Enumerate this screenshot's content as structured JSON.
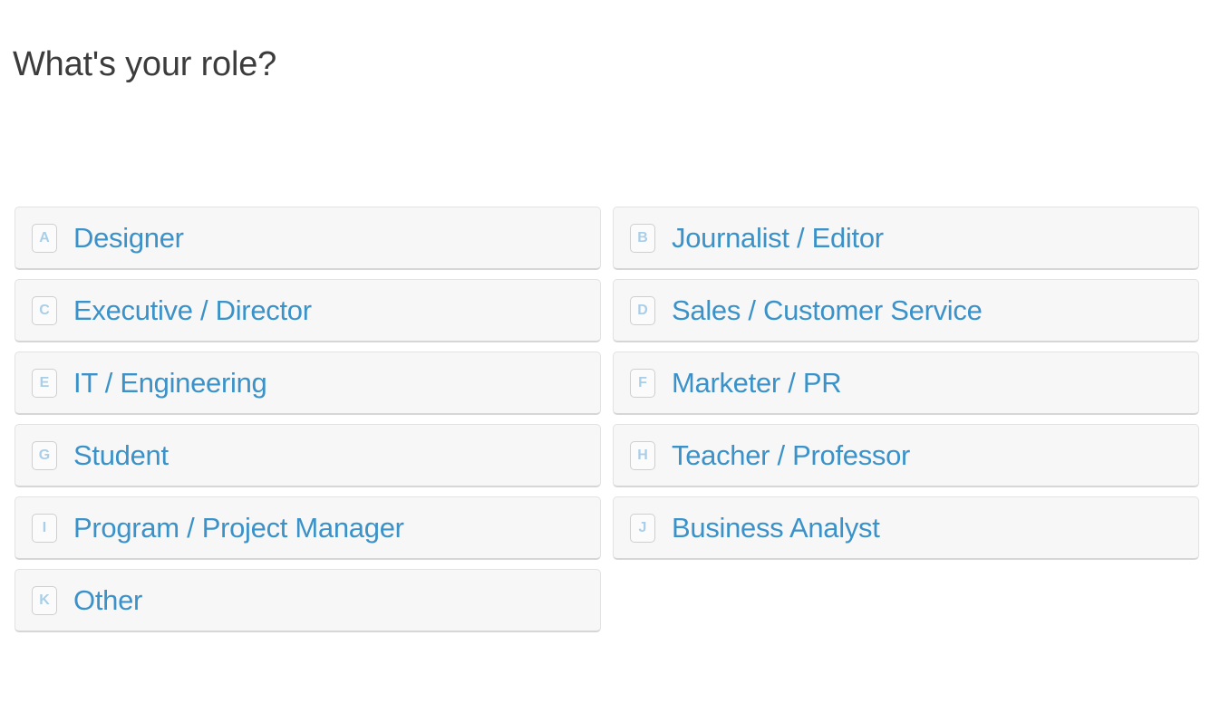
{
  "page": {
    "title": "What's your role?",
    "background_color": "#ffffff",
    "title_color": "#3c3c3c",
    "option_label_color": "#3a92c9",
    "option_card_background": "#f7f7f7",
    "option_card_border_color": "#e2e2e2",
    "key_badge_text_color": "#a9cfe8",
    "key_badge_border_color": "#cfcfcf"
  },
  "options": [
    {
      "key": "A",
      "label": "Designer"
    },
    {
      "key": "B",
      "label": "Journalist / Editor"
    },
    {
      "key": "C",
      "label": "Executive / Director"
    },
    {
      "key": "D",
      "label": "Sales / Customer Service"
    },
    {
      "key": "E",
      "label": "IT / Engineering"
    },
    {
      "key": "F",
      "label": "Marketer / PR"
    },
    {
      "key": "G",
      "label": "Student"
    },
    {
      "key": "H",
      "label": "Teacher / Professor"
    },
    {
      "key": "I",
      "label": "Program / Project Manager"
    },
    {
      "key": "J",
      "label": "Business Analyst"
    },
    {
      "key": "K",
      "label": "Other"
    }
  ]
}
